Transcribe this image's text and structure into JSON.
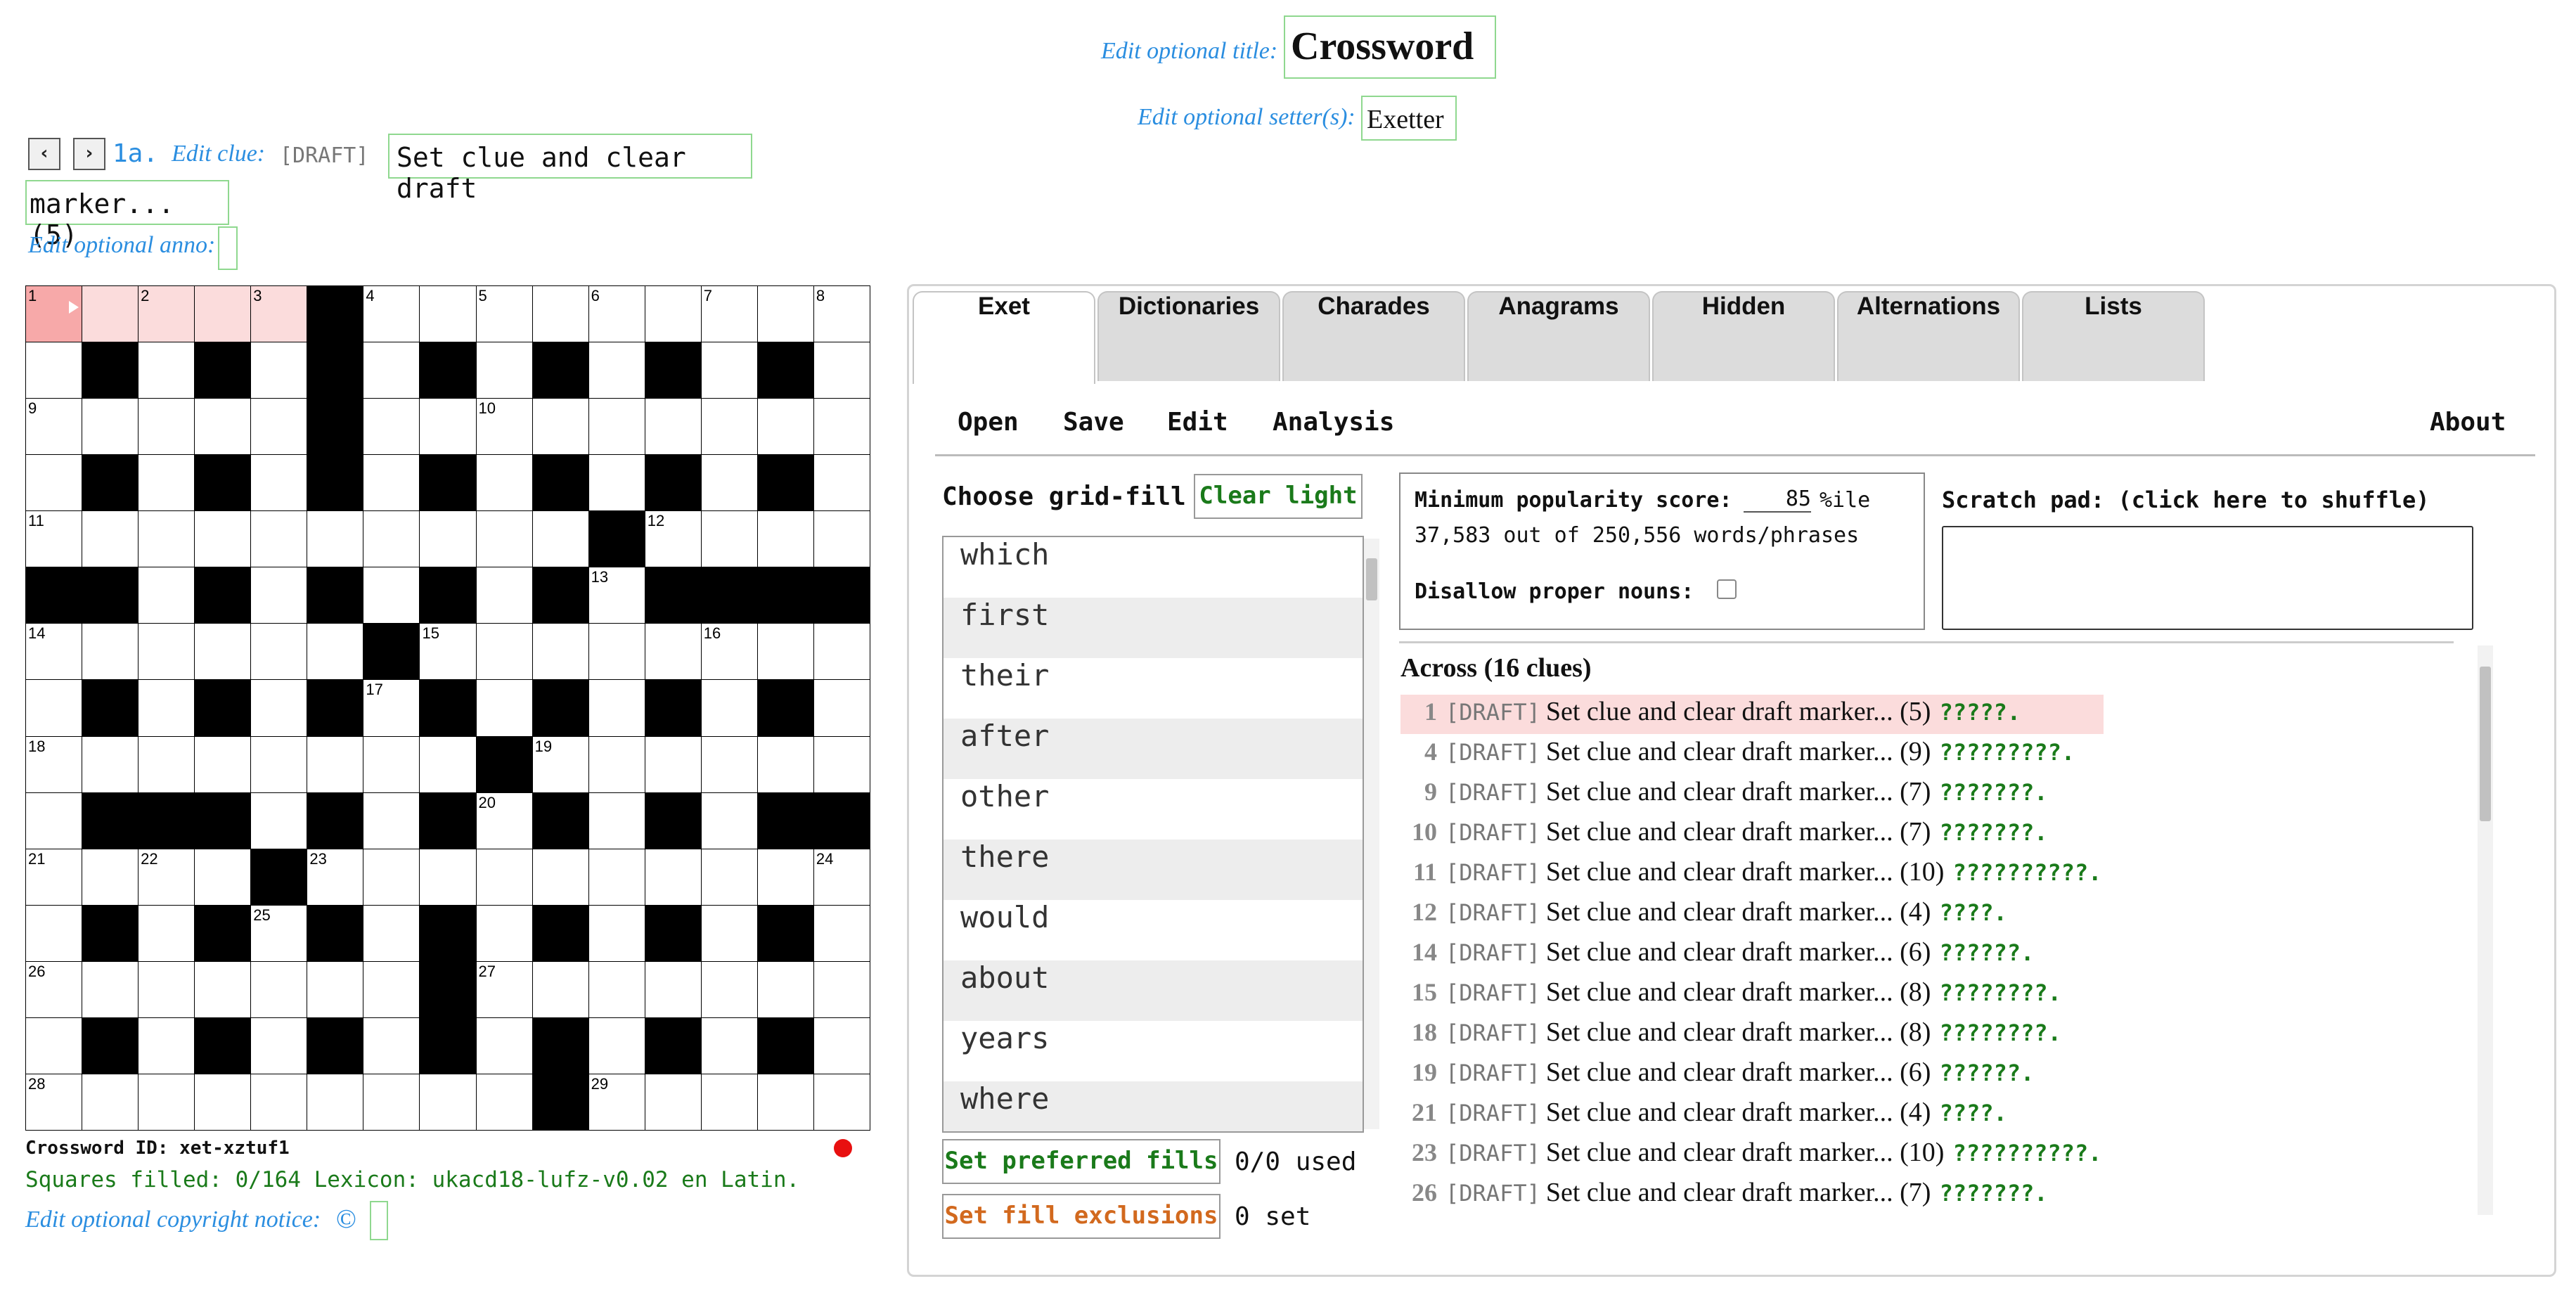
{
  "title": {
    "hint": "Edit optional title:",
    "value": "Crossword"
  },
  "setter": {
    "hint": "Edit optional setter(s):",
    "value": "Exetter"
  },
  "current_clue": {
    "prev": "‹",
    "next": "›",
    "label": "1a.",
    "hint": "Edit clue:",
    "draft": "[DRAFT]",
    "text_line1": "Set clue and clear draft",
    "text_line2": "marker... (5)"
  },
  "anno_hint": "Edit optional anno:",
  "grid": {
    "rows": [
      "WWWWWBWWWWWWWWW",
      "WBWBWBWBWBWBWBW",
      "WWWWWBWWWWWWWWW",
      "WBWBWBWBWBWBWBW",
      "WWWWWWWWWWBWWWW",
      "BBWBWBWBWBWBBBB",
      "WWWWWWBWWWWWWWW",
      "WBWBWBWBWBWBWBW",
      "WWWWWWWWBWWWWWW",
      "WBBBWBWBWBWBWBB",
      "WWWWBWWWWWWWWWW",
      "WBWBWBWBWBWBWBW",
      "WWWWWWWBWWWWWWW",
      "WBWBWBWBWBWBWBW",
      "WWWWWWWWWBWWWWW"
    ],
    "numbers": [
      {
        "r": 0,
        "c": 0,
        "n": "1"
      },
      {
        "r": 0,
        "c": 2,
        "n": "2"
      },
      {
        "r": 0,
        "c": 4,
        "n": "3"
      },
      {
        "r": 0,
        "c": 6,
        "n": "4"
      },
      {
        "r": 0,
        "c": 8,
        "n": "5"
      },
      {
        "r": 0,
        "c": 10,
        "n": "6"
      },
      {
        "r": 0,
        "c": 12,
        "n": "7"
      },
      {
        "r": 0,
        "c": 14,
        "n": "8"
      },
      {
        "r": 2,
        "c": 0,
        "n": "9"
      },
      {
        "r": 2,
        "c": 8,
        "n": "10"
      },
      {
        "r": 4,
        "c": 0,
        "n": "11"
      },
      {
        "r": 4,
        "c": 11,
        "n": "12"
      },
      {
        "r": 5,
        "c": 10,
        "n": "13"
      },
      {
        "r": 6,
        "c": 0,
        "n": "14"
      },
      {
        "r": 6,
        "c": 7,
        "n": "15"
      },
      {
        "r": 6,
        "c": 12,
        "n": "16"
      },
      {
        "r": 7,
        "c": 6,
        "n": "17"
      },
      {
        "r": 8,
        "c": 0,
        "n": "18"
      },
      {
        "r": 8,
        "c": 9,
        "n": "19"
      },
      {
        "r": 9,
        "c": 8,
        "n": "20"
      },
      {
        "r": 10,
        "c": 0,
        "n": "21"
      },
      {
        "r": 10,
        "c": 2,
        "n": "22"
      },
      {
        "r": 10,
        "c": 5,
        "n": "23"
      },
      {
        "r": 10,
        "c": 14,
        "n": "24"
      },
      {
        "r": 11,
        "c": 4,
        "n": "25"
      },
      {
        "r": 12,
        "c": 0,
        "n": "26"
      },
      {
        "r": 12,
        "c": 8,
        "n": "27"
      },
      {
        "r": 14,
        "c": 0,
        "n": "28"
      },
      {
        "r": 14,
        "c": 10,
        "n": "29"
      }
    ],
    "current_cell": {
      "r": 0,
      "c": 0
    },
    "highlight": {
      "row": 0,
      "from": 1,
      "to": 4
    }
  },
  "crossword_id": "Crossword ID: xet-xztuf1",
  "status": "Squares filled: 0/164 Lexicon: ukacd18-lufz-v0.02 en Latin.",
  "copyright": {
    "hint": "Edit optional copyright notice:",
    "symbol": "©"
  },
  "tabs": [
    "Exet",
    "Dictionaries",
    "Charades",
    "Anagrams",
    "Hidden",
    "Alternations",
    "Lists"
  ],
  "menu": {
    "open": "Open",
    "save": "Save",
    "edit": "Edit",
    "analysis": "Analysis",
    "about": "About"
  },
  "gridfill": {
    "label": "Choose grid-fill",
    "clear_light": "Clear light",
    "words": [
      "which",
      "first",
      "their",
      "after",
      "other",
      "there",
      "would",
      "about",
      "years",
      "where"
    ],
    "preferred": "Set preferred fills",
    "preferred_count": "0/0 used",
    "exclusions": "Set fill exclusions",
    "exclusions_count": "0 set"
  },
  "popularity": {
    "label": "Minimum popularity score:",
    "value": "85",
    "unit": "%ile",
    "count": "37,583 out of 250,556 words/phrases",
    "proper_label": "Disallow proper nouns:"
  },
  "scratch": {
    "label": "Scratch pad: (click here to shuffle)"
  },
  "across": {
    "heading": "Across (16 clues)",
    "clues": [
      {
        "num": "1",
        "draft": "[DRAFT]",
        "text": "Set clue and clear draft marker... (5)",
        "fill": "?????."
      },
      {
        "num": "4",
        "draft": "[DRAFT]",
        "text": "Set clue and clear draft marker... (9)",
        "fill": "?????????."
      },
      {
        "num": "9",
        "draft": "[DRAFT]",
        "text": "Set clue and clear draft marker... (7)",
        "fill": "???????."
      },
      {
        "num": "10",
        "draft": "[DRAFT]",
        "text": "Set clue and clear draft marker... (7)",
        "fill": "???????."
      },
      {
        "num": "11",
        "draft": "[DRAFT]",
        "text": "Set clue and clear draft marker... (10)",
        "fill": "??????????."
      },
      {
        "num": "12",
        "draft": "[DRAFT]",
        "text": "Set clue and clear draft marker... (4)",
        "fill": "????."
      },
      {
        "num": "14",
        "draft": "[DRAFT]",
        "text": "Set clue and clear draft marker... (6)",
        "fill": "??????."
      },
      {
        "num": "15",
        "draft": "[DRAFT]",
        "text": "Set clue and clear draft marker... (8)",
        "fill": "????????."
      },
      {
        "num": "18",
        "draft": "[DRAFT]",
        "text": "Set clue and clear draft marker... (8)",
        "fill": "????????."
      },
      {
        "num": "19",
        "draft": "[DRAFT]",
        "text": "Set clue and clear draft marker... (6)",
        "fill": "??????."
      },
      {
        "num": "21",
        "draft": "[DRAFT]",
        "text": "Set clue and clear draft marker... (4)",
        "fill": "????."
      },
      {
        "num": "23",
        "draft": "[DRAFT]",
        "text": "Set clue and clear draft marker... (10)",
        "fill": "??????????."
      },
      {
        "num": "26",
        "draft": "[DRAFT]",
        "text": "Set clue and clear draft marker... (7)",
        "fill": "???????."
      }
    ]
  },
  "colors": {
    "hint": "#2b8ee0",
    "green_border": "#8fd88f",
    "draft_green": "#1a7a1a",
    "exclude_orange": "#d2691e",
    "highlight": "#fbdcdc",
    "current": "#f7a9a9"
  }
}
